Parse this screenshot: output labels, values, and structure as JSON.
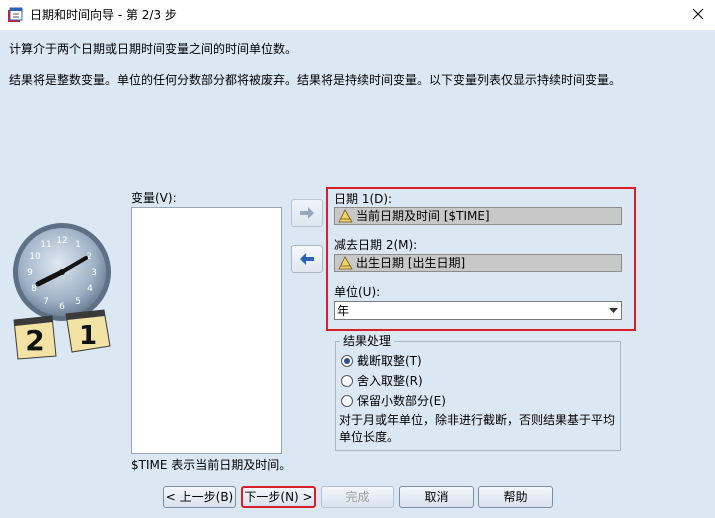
{
  "window": {
    "title": "日期和时间向导 - 第 2/3 步"
  },
  "description": {
    "line1": "计算介于两个日期或日期时间变量之间的时间单位数。",
    "line2": "结果将是整数变量。单位的任何分数部分都将被废弃。结果将是持续时间变量。以下变量列表仅显示持续时间变量。"
  },
  "variables": {
    "label": "变量(V):",
    "items": [],
    "footnote": "$TIME 表示当前日期及时间。"
  },
  "fields": {
    "date1_label": "日期 1(D):",
    "date1_value": "当前日期及时间 [$TIME]",
    "date2_label": "减去日期 2(M):",
    "date2_value": "出生日期 [出生日期]",
    "unit_label": "单位(U):",
    "unit_value": "年"
  },
  "result_handling": {
    "legend": "结果处理",
    "options": [
      {
        "label": "截断取整(T)",
        "selected": true
      },
      {
        "label": "舍入取整(R)",
        "selected": false
      },
      {
        "label": "保留小数部分(E)",
        "selected": false
      }
    ],
    "note": "对于月或年单位，除非进行截断，否则结果基于平均单位长度。"
  },
  "buttons": {
    "back": "< 上一步(B)",
    "next": "下一步(N) >",
    "finish": "完成",
    "cancel": "取消",
    "help": "帮助"
  },
  "calendar_pages": [
    "2",
    "1"
  ],
  "clock_numbers": [
    "12",
    "1",
    "2",
    "3",
    "4",
    "5",
    "6",
    "7",
    "8",
    "9",
    "10",
    "11"
  ],
  "colors": {
    "background": "#dce7f4",
    "highlight_border": "#d81f2a",
    "arrow_button_icon": "#2b63b8"
  },
  "icons": {
    "title": "date-time-wizard-icon",
    "close": "close-icon",
    "date_variable": "calendar-ruler-icon",
    "move_right": "arrow-right-icon",
    "move_left": "arrow-left-icon"
  }
}
